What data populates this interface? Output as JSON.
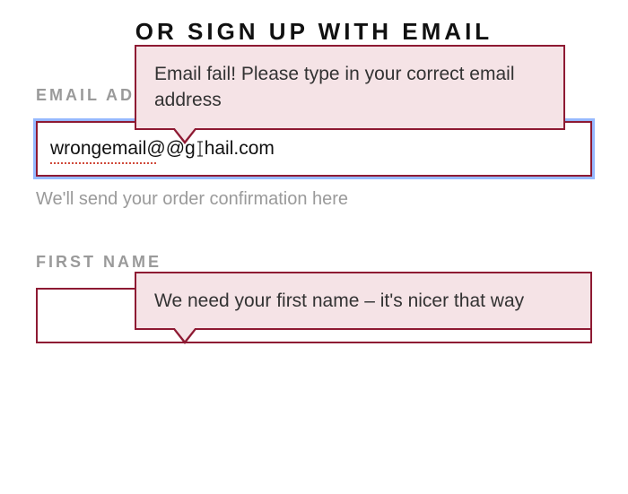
{
  "heading": "OR SIGN UP WITH EMAIL",
  "tooltips": {
    "email_error": "Email fail! Please type in your correct email address",
    "firstname_error": "We need your first name – it's nicer that way"
  },
  "email": {
    "label": "EMAIL ADDRESS",
    "value_part1": "wrongemail@@g",
    "value_part2": "hail.com",
    "helper": "We'll send your order confirmation here"
  },
  "firstname": {
    "label": "FIRST NAME",
    "value": ""
  }
}
